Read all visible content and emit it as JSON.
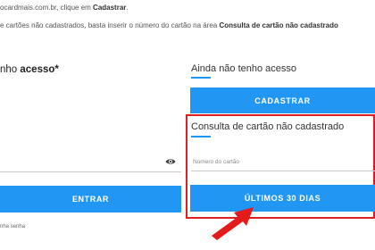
{
  "intro": {
    "line1_text": "ocardmais.com.br, clique em ",
    "line1_link": "Cadastrar",
    "line1_end": ".",
    "line2_text": "e cartões não cadastrados, basta inserir o número do cartão na área ",
    "line2_bold": "Consulta de cartão não cadastrado"
  },
  "login": {
    "heading_prefix": "nho ",
    "heading_bold": "acesso*",
    "button_label": "ENTRAR",
    "forgot_label": "nha senha"
  },
  "register": {
    "heading": "Ainda não tenho acesso",
    "button_label": "CADASTRAR"
  },
  "card_query": {
    "heading": "Consulta de cartão não cadastrado",
    "card_number_label": "Número do cartão",
    "button_label": "ÚLTIMOS 30 DIAS"
  },
  "colors": {
    "accent": "#2196f3",
    "highlight": "#e02020"
  },
  "icons": {
    "password_toggle": "eye-icon",
    "annotation": "red-arrow"
  }
}
